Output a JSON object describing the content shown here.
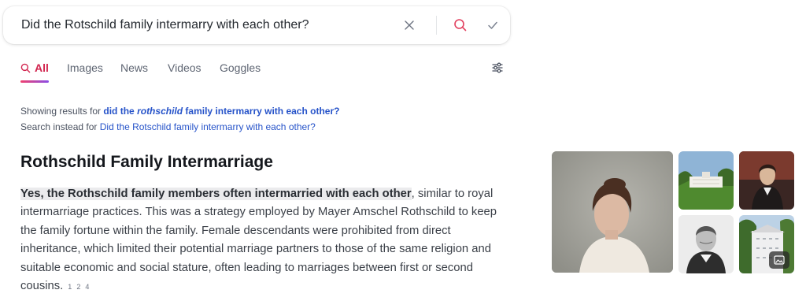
{
  "search": {
    "query": "Did the Rotschild family intermarry with each other?"
  },
  "tabs": [
    {
      "label": "All",
      "active": true
    },
    {
      "label": "Images"
    },
    {
      "label": "News"
    },
    {
      "label": "Videos"
    },
    {
      "label": "Goggles"
    }
  ],
  "spelling": {
    "showing_prefix": "Showing results for",
    "corrected_before": "did the",
    "corrected_word": "rothschild",
    "corrected_after": "family intermarry with each other?",
    "instead_prefix": "Search instead for",
    "original_query": "Did the Rotschild family intermarry with each other?"
  },
  "answer": {
    "title": "Rothschild Family Intermarriage",
    "highlight": "Yes, the Rothschild family members often intermarried with each other",
    "body": ", similar to royal intermarriage practices. This was a strategy employed by Mayer Amschel Rothschild to keep the family fortune within the family. Female descendants were prohibited from direct inheritance, which limited their potential marriage partners to those of the same religion and suitable economic and social stature, often leading to marriages between first or second cousins.",
    "citations": [
      "1",
      "2",
      "4"
    ]
  },
  "icons": {
    "clear": "close-icon",
    "search": "search-icon",
    "submit": "check-icon",
    "filters": "sliders-icon",
    "more_images": "image-icon"
  },
  "colors": {
    "accent": "#d1234d",
    "link": "#2653c9"
  }
}
